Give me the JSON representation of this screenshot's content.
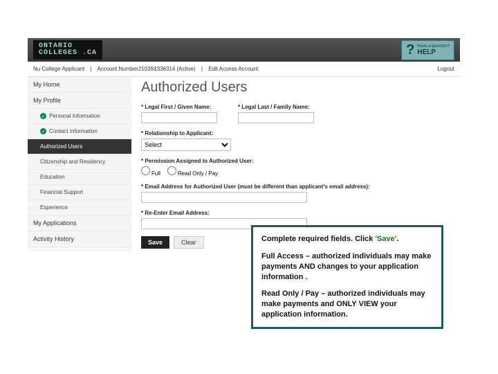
{
  "logo": {
    "line1": "ONTARIO",
    "line2": "COLLEGES .CA"
  },
  "help": {
    "q": "?",
    "line1": "Have a question?",
    "line2": "HELP"
  },
  "subbar": {
    "applicant": "Nu College Applicant",
    "account": "Account Number210391336314 (Active)",
    "edit": "Edit Access Account",
    "logout": "Logout"
  },
  "sidebar": {
    "home": "My Home",
    "profile": "My Profile",
    "personal": "Personal Information",
    "contact": "Contact Information",
    "authusers": "Authorized Users",
    "citizenship": "Citizenship and Residency",
    "education": "Education",
    "finsupport": "Financial Support",
    "experience": "Experience",
    "applications": "My Applications",
    "activity": "Activity History"
  },
  "main": {
    "heading": "Authorized Users",
    "firstname_label": "* Legal First / Given Name:",
    "lastname_label": "* Legal Last / Family Name:",
    "relationship_label": "* Relationship to Applicant:",
    "relationship_value": "Select",
    "permission_label": "* Permission Assigned to Authorized User:",
    "radio_full": "Full",
    "radio_readonly": "Read Only / Pay",
    "email_label": "* Email Address for Authorized User (must be different than applicant's email address):",
    "reemail_label": "* Re-Enter Email Address:",
    "save": "Save",
    "clear": "Clear"
  },
  "callout": {
    "p1a": "Complete required fields. Click ",
    "p1b": "'Save'",
    "p1c": ".",
    "p2": "Full Access – authorized individuals may make payments AND changes to your application information .",
    "p3": "Read Only / Pay – authorized individuals may make payments and ONLY VIEW your application information."
  }
}
